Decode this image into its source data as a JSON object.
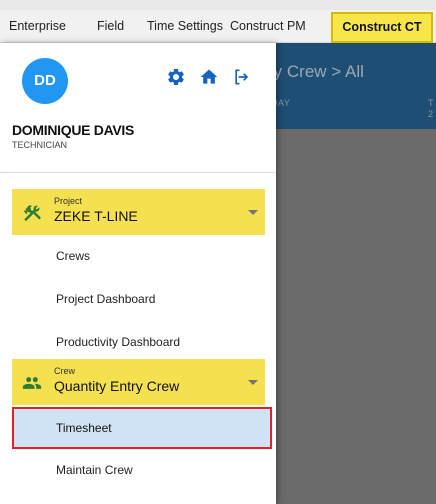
{
  "tabs": {
    "items": [
      "Enterprise",
      "Field",
      "Time Settings",
      "Construct PM"
    ],
    "active": "Construct CT"
  },
  "background": {
    "title": "ry Crew  >  All",
    "col1": "IDAY",
    "col2_line1": "T",
    "col2_line2": "2"
  },
  "drawer": {
    "avatar_initials": "DD",
    "user_name": "DOMINIQUE DAVIS",
    "user_role": "TECHNICIAN",
    "project": {
      "label": "Project",
      "value": "ZEKE T-LINE"
    },
    "project_items": [
      "Crews",
      "Project Dashboard",
      "Productivity Dashboard"
    ],
    "crew": {
      "label": "Crew",
      "value": "Quantity Entry Crew"
    },
    "crew_items": {
      "selected": "Timesheet",
      "other": "Maintain Crew"
    }
  },
  "colors": {
    "accent_yellow": "#f5e04f",
    "avatar_blue": "#2196f3",
    "header_blue": "#1e4e73",
    "icon_blue": "#1565c0",
    "icon_green": "#2e7d32",
    "selected_bg": "#cfe3f5",
    "selected_border": "#e3202a"
  },
  "icons": {
    "settings": "gear-icon",
    "home": "home-icon",
    "logout": "logout-icon",
    "project": "tools-icon",
    "crew": "people-icon",
    "expand": "chevron-down-icon"
  }
}
